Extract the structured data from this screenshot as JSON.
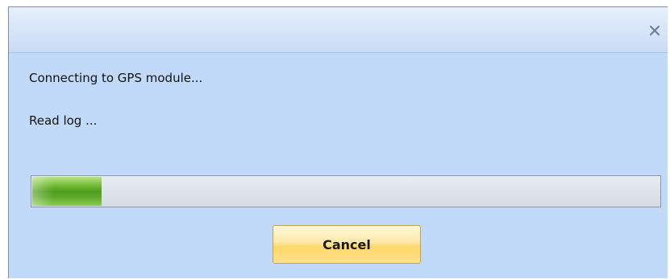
{
  "dialog": {
    "close_icon": "close-icon",
    "status_lines": [
      "Connecting to GPS module...",
      "Read log ..."
    ],
    "progress": {
      "fraction": 0.11,
      "fill_color": "#5ea82a"
    },
    "cancel_label": "Cancel"
  },
  "colors": {
    "background": "#c2dafa",
    "titlebar": "#dae7f8",
    "button": "#ffe08a"
  }
}
